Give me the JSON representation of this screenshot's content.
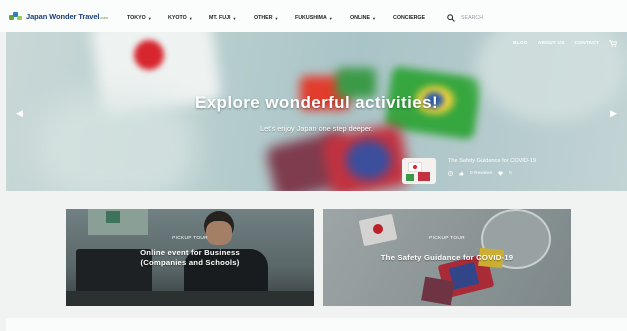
{
  "brand": {
    "name": "Japan Wonder Travel",
    "suffix": ".com"
  },
  "nav": {
    "items": [
      {
        "label": "TOKYO",
        "caret": "▼"
      },
      {
        "label": "KYOTO",
        "caret": "▼"
      },
      {
        "label": "MT. FUJI",
        "caret": "▼"
      },
      {
        "label": "OTHER",
        "caret": "▼"
      },
      {
        "label": "FUKUSHIMA",
        "caret": "▼"
      },
      {
        "label": "ONLINE",
        "caret": "▼"
      },
      {
        "label": "CONCIERGE",
        "caret": ""
      }
    ],
    "search_placeholder": "SEARCH"
  },
  "hero": {
    "links": [
      "BLOG",
      "ABOUT US",
      "CONTACT"
    ],
    "title": "Explore wonderful activities!",
    "subtitle": "Let's enjoy Japan one step deeper.",
    "card": {
      "title": "The Safety Guidance for COVID-19",
      "reviews": "0 Reviews",
      "likes": "0"
    }
  },
  "pickups": [
    {
      "tag": "PICKUP TOUR",
      "title": "Online event for Business (Companies and Schools)"
    },
    {
      "tag": "PICKUP TOUR",
      "title": "The Safety Guidance for COVID-19"
    }
  ],
  "colors": {
    "brand_navy": "#1d3f77",
    "brand_green": "#5b8f2c",
    "hero_bg": "#b3c9cb"
  },
  "icons": [
    "search-icon",
    "cart-icon",
    "arrow-left-icon",
    "arrow-right-icon",
    "clock-icon",
    "thumbs-up-icon",
    "heart-icon"
  ]
}
